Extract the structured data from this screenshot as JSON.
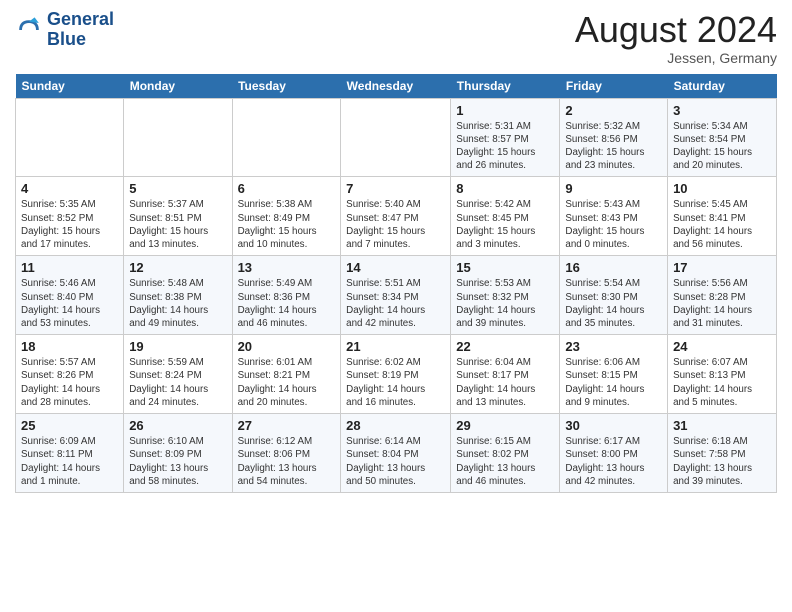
{
  "header": {
    "logo_line1": "General",
    "logo_line2": "Blue",
    "month": "August 2024",
    "location": "Jessen, Germany"
  },
  "weekdays": [
    "Sunday",
    "Monday",
    "Tuesday",
    "Wednesday",
    "Thursday",
    "Friday",
    "Saturday"
  ],
  "weeks": [
    [
      {
        "day": "",
        "detail": ""
      },
      {
        "day": "",
        "detail": ""
      },
      {
        "day": "",
        "detail": ""
      },
      {
        "day": "",
        "detail": ""
      },
      {
        "day": "1",
        "detail": "Sunrise: 5:31 AM\nSunset: 8:57 PM\nDaylight: 15 hours\nand 26 minutes."
      },
      {
        "day": "2",
        "detail": "Sunrise: 5:32 AM\nSunset: 8:56 PM\nDaylight: 15 hours\nand 23 minutes."
      },
      {
        "day": "3",
        "detail": "Sunrise: 5:34 AM\nSunset: 8:54 PM\nDaylight: 15 hours\nand 20 minutes."
      }
    ],
    [
      {
        "day": "4",
        "detail": "Sunrise: 5:35 AM\nSunset: 8:52 PM\nDaylight: 15 hours\nand 17 minutes."
      },
      {
        "day": "5",
        "detail": "Sunrise: 5:37 AM\nSunset: 8:51 PM\nDaylight: 15 hours\nand 13 minutes."
      },
      {
        "day": "6",
        "detail": "Sunrise: 5:38 AM\nSunset: 8:49 PM\nDaylight: 15 hours\nand 10 minutes."
      },
      {
        "day": "7",
        "detail": "Sunrise: 5:40 AM\nSunset: 8:47 PM\nDaylight: 15 hours\nand 7 minutes."
      },
      {
        "day": "8",
        "detail": "Sunrise: 5:42 AM\nSunset: 8:45 PM\nDaylight: 15 hours\nand 3 minutes."
      },
      {
        "day": "9",
        "detail": "Sunrise: 5:43 AM\nSunset: 8:43 PM\nDaylight: 15 hours\nand 0 minutes."
      },
      {
        "day": "10",
        "detail": "Sunrise: 5:45 AM\nSunset: 8:41 PM\nDaylight: 14 hours\nand 56 minutes."
      }
    ],
    [
      {
        "day": "11",
        "detail": "Sunrise: 5:46 AM\nSunset: 8:40 PM\nDaylight: 14 hours\nand 53 minutes."
      },
      {
        "day": "12",
        "detail": "Sunrise: 5:48 AM\nSunset: 8:38 PM\nDaylight: 14 hours\nand 49 minutes."
      },
      {
        "day": "13",
        "detail": "Sunrise: 5:49 AM\nSunset: 8:36 PM\nDaylight: 14 hours\nand 46 minutes."
      },
      {
        "day": "14",
        "detail": "Sunrise: 5:51 AM\nSunset: 8:34 PM\nDaylight: 14 hours\nand 42 minutes."
      },
      {
        "day": "15",
        "detail": "Sunrise: 5:53 AM\nSunset: 8:32 PM\nDaylight: 14 hours\nand 39 minutes."
      },
      {
        "day": "16",
        "detail": "Sunrise: 5:54 AM\nSunset: 8:30 PM\nDaylight: 14 hours\nand 35 minutes."
      },
      {
        "day": "17",
        "detail": "Sunrise: 5:56 AM\nSunset: 8:28 PM\nDaylight: 14 hours\nand 31 minutes."
      }
    ],
    [
      {
        "day": "18",
        "detail": "Sunrise: 5:57 AM\nSunset: 8:26 PM\nDaylight: 14 hours\nand 28 minutes."
      },
      {
        "day": "19",
        "detail": "Sunrise: 5:59 AM\nSunset: 8:24 PM\nDaylight: 14 hours\nand 24 minutes."
      },
      {
        "day": "20",
        "detail": "Sunrise: 6:01 AM\nSunset: 8:21 PM\nDaylight: 14 hours\nand 20 minutes."
      },
      {
        "day": "21",
        "detail": "Sunrise: 6:02 AM\nSunset: 8:19 PM\nDaylight: 14 hours\nand 16 minutes."
      },
      {
        "day": "22",
        "detail": "Sunrise: 6:04 AM\nSunset: 8:17 PM\nDaylight: 14 hours\nand 13 minutes."
      },
      {
        "day": "23",
        "detail": "Sunrise: 6:06 AM\nSunset: 8:15 PM\nDaylight: 14 hours\nand 9 minutes."
      },
      {
        "day": "24",
        "detail": "Sunrise: 6:07 AM\nSunset: 8:13 PM\nDaylight: 14 hours\nand 5 minutes."
      }
    ],
    [
      {
        "day": "25",
        "detail": "Sunrise: 6:09 AM\nSunset: 8:11 PM\nDaylight: 14 hours\nand 1 minute."
      },
      {
        "day": "26",
        "detail": "Sunrise: 6:10 AM\nSunset: 8:09 PM\nDaylight: 13 hours\nand 58 minutes."
      },
      {
        "day": "27",
        "detail": "Sunrise: 6:12 AM\nSunset: 8:06 PM\nDaylight: 13 hours\nand 54 minutes."
      },
      {
        "day": "28",
        "detail": "Sunrise: 6:14 AM\nSunset: 8:04 PM\nDaylight: 13 hours\nand 50 minutes."
      },
      {
        "day": "29",
        "detail": "Sunrise: 6:15 AM\nSunset: 8:02 PM\nDaylight: 13 hours\nand 46 minutes."
      },
      {
        "day": "30",
        "detail": "Sunrise: 6:17 AM\nSunset: 8:00 PM\nDaylight: 13 hours\nand 42 minutes."
      },
      {
        "day": "31",
        "detail": "Sunrise: 6:18 AM\nSunset: 7:58 PM\nDaylight: 13 hours\nand 39 minutes."
      }
    ]
  ]
}
